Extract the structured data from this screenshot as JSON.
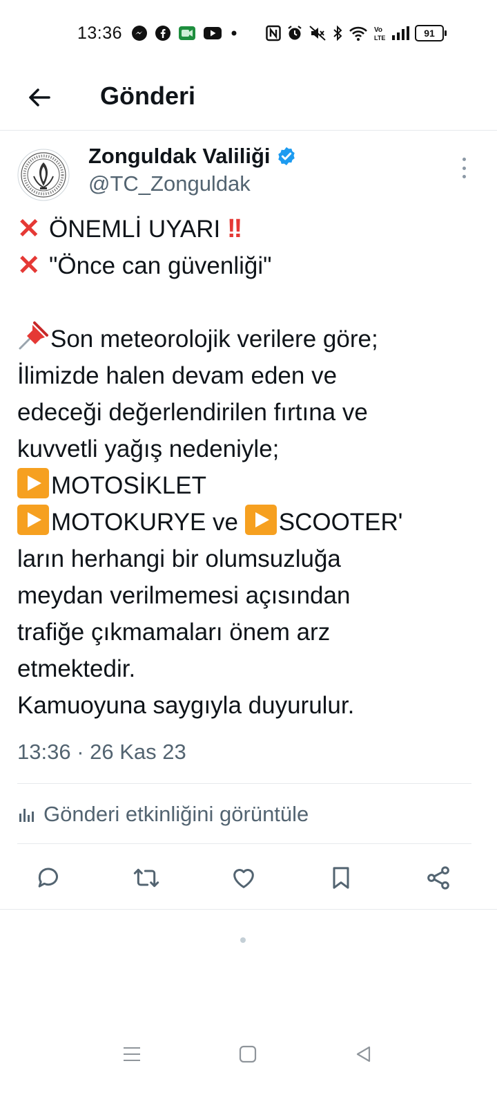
{
  "status_bar": {
    "time": "13:36",
    "battery": "91",
    "icons": [
      "messenger-icon",
      "facebook-icon",
      "meet-icon",
      "youtube-icon",
      "dot-icon",
      "nfc-icon",
      "alarm-icon",
      "mute-icon",
      "bluetooth-icon",
      "wifi-icon",
      "volte-icon",
      "signal-icon",
      "battery-icon"
    ]
  },
  "header": {
    "title": "Gönderi"
  },
  "post": {
    "author_name": "Zonguldak Valiliği",
    "handle": "@TC_Zonguldak",
    "lines": [
      {
        "prefix": "x",
        "text": "ÖNEMLİ UYARI ",
        "suffix": "!!"
      },
      {
        "prefix": "x",
        "text": "\"Önce can güvenliği\""
      },
      {
        "text": ""
      },
      {
        "prefix": "pin",
        "text": "Son meteorolojik verilere göre;"
      },
      {
        "text": "İlimizde halen devam eden ve"
      },
      {
        "text": "edeceği değerlendirilen fırtına ve"
      },
      {
        "text": "kuvvetli yağış nedeniyle;"
      },
      {
        "prefix": "play",
        "text": "MOTOSİKLET"
      },
      {
        "prefix": "play",
        "text": "MOTOKURYE ve ",
        "play2": "SCOOTER'"
      },
      {
        "text": "ların herhangi bir olumsuzluğa"
      },
      {
        "text": "meydan verilmemesi açısından"
      },
      {
        "text": "trafiğe çıkmamaları önem arz"
      },
      {
        "text": "etmektedir."
      },
      {
        "text": "Kamuoyuna saygıyla duyurulur."
      }
    ],
    "timestamp": "13:36 · 26 Kas 23",
    "analytics_label": "Gönderi etkinliğini görüntüle",
    "accent_color": "#1d9bf0"
  },
  "actions": [
    "reply-icon",
    "repost-icon",
    "like-icon",
    "bookmark-icon",
    "share-icon"
  ],
  "nav_bar": [
    "recents-icon",
    "home-icon",
    "back-icon"
  ]
}
